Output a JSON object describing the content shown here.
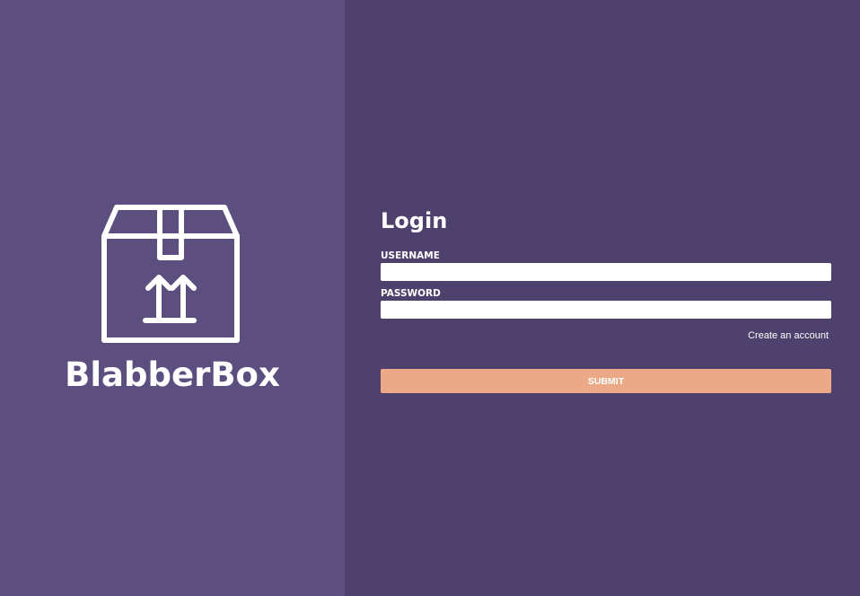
{
  "brand": {
    "name": "BlabberBox",
    "logo_icon": "package-box-arrows-up-icon",
    "panel_color": "#5c4f7f"
  },
  "login": {
    "title": "Login",
    "panel_color": "#4e416d",
    "username_label": "USERNAME",
    "username_value": "",
    "password_label": "PASSWORD",
    "password_value": "",
    "create_account_link": "Create an account",
    "submit_label": "SUBMIT",
    "submit_color": "#eca987"
  }
}
